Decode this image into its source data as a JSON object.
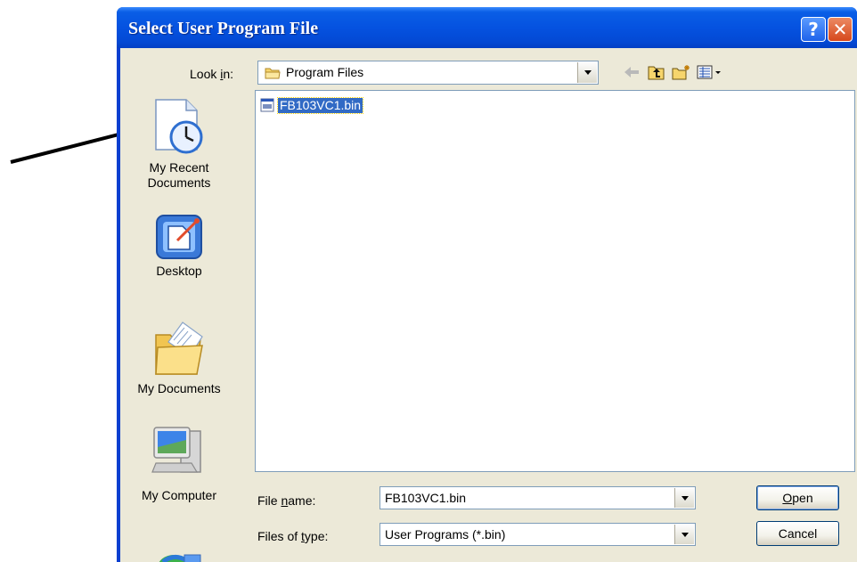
{
  "window": {
    "title": "Select User Program File"
  },
  "title_buttons": {
    "help": "?",
    "close": "✕"
  },
  "look_in": {
    "label_pre": "Look ",
    "label_accel": "i",
    "label_post": "n:",
    "value": "Program Files"
  },
  "toolbar": {
    "icons": [
      "back-icon",
      "up-folder-icon",
      "new-folder-icon",
      "views-menu-icon"
    ]
  },
  "places": [
    {
      "label": "My Recent Documents",
      "icon": "recent-documents-icon"
    },
    {
      "label": "Desktop",
      "icon": "desktop-icon"
    },
    {
      "label": "My Documents",
      "icon": "my-documents-icon"
    },
    {
      "label": "My Computer",
      "icon": "my-computer-icon"
    },
    {
      "label": "",
      "icon": "network-places-icon"
    }
  ],
  "files": [
    {
      "name": "FB103VC1.bin",
      "selected": true
    }
  ],
  "file_name": {
    "label_pre": "File ",
    "label_accel": "n",
    "label_post": "ame:",
    "value": "FB103VC1.bin"
  },
  "file_type": {
    "label_pre": "Files of ",
    "label_accel": "t",
    "label_post": "ype:",
    "value": "User Programs (*.bin)"
  },
  "buttons": {
    "open_accel": "O",
    "open_rest": "pen",
    "cancel": "Cancel"
  },
  "colors": {
    "title_blue": "#0552e0",
    "selection": "#316ac5",
    "dialog_bg": "#ece9d8"
  }
}
